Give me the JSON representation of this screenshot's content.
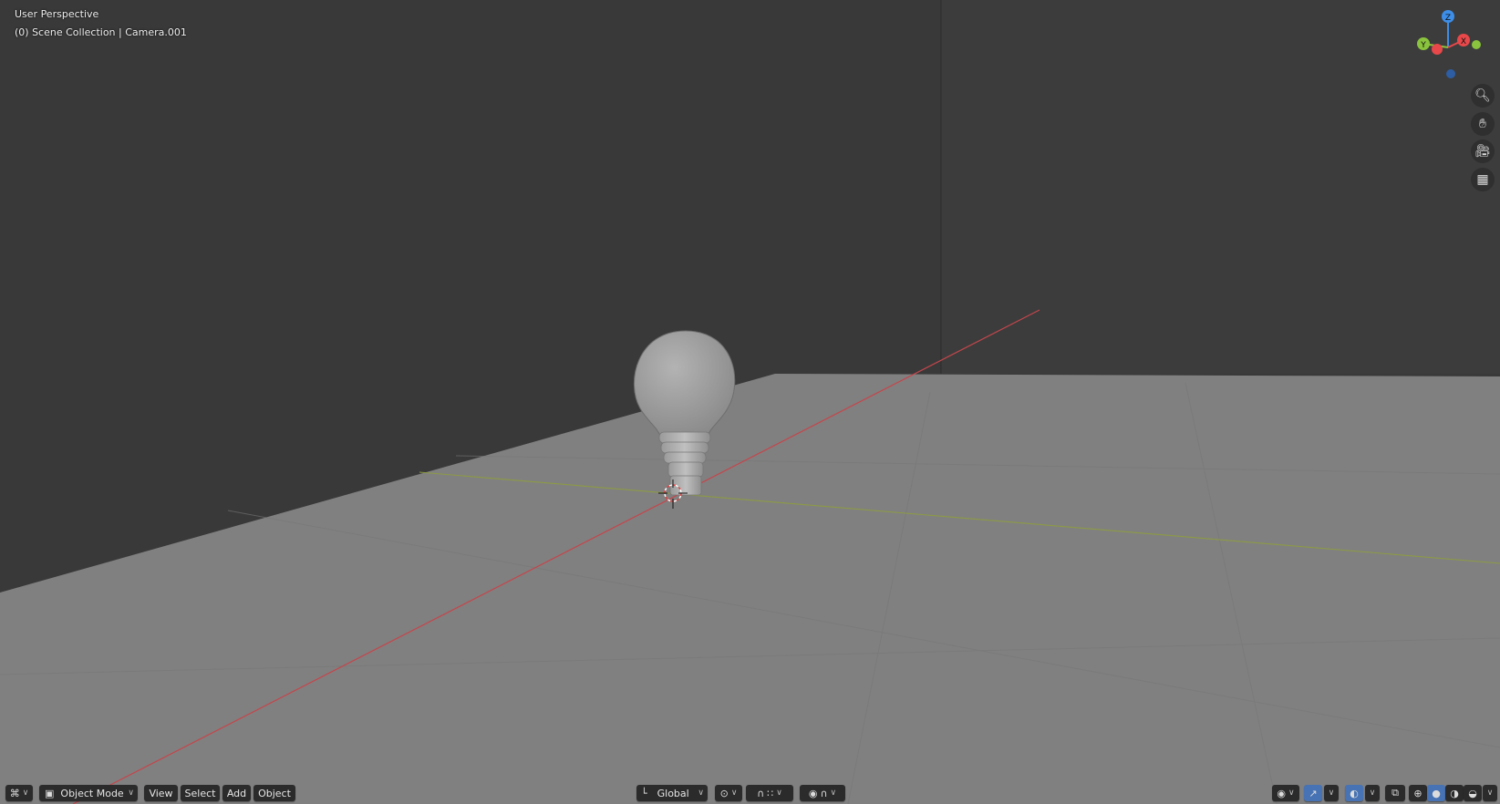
{
  "viewport": {
    "overlay_line1": "User Perspective",
    "overlay_line2": "(0) Scene Collection | Camera.001"
  },
  "gizmo": {
    "z_label": "Z",
    "x_label": "X",
    "y_label": "Y",
    "colors": {
      "x": "#e8484a",
      "y": "#8ac33d",
      "z": "#3d8ee8"
    }
  },
  "nav_buttons": [
    {
      "icon": "zoom-icon"
    },
    {
      "icon": "pan-hand-icon"
    },
    {
      "icon": "camera-view-icon"
    },
    {
      "icon": "ortho-grid-icon"
    }
  ],
  "header": {
    "editor_type_icon": "3d-viewport-icon",
    "mode_label": "Object Mode",
    "menus": [
      "View",
      "Select",
      "Add",
      "Object"
    ],
    "orientation_label": "Global",
    "pivot_icon": "pivot-icon",
    "snap_icon": "snap-magnet-icon",
    "snap_target_icon": "snap-increment-icon",
    "proportional_icon": "proportional-edit-icon",
    "falloff_icon": "falloff-curve-icon",
    "visibility_icon": "eye-icon",
    "gizmo_toggle_icon": "gizmo-arrow-icon",
    "overlay_toggle_icon": "overlay-icon",
    "xray_icon": "xray-icon",
    "shading_icons": [
      "wireframe-icon",
      "solid-icon",
      "material-icon",
      "rendered-icon"
    ]
  }
}
